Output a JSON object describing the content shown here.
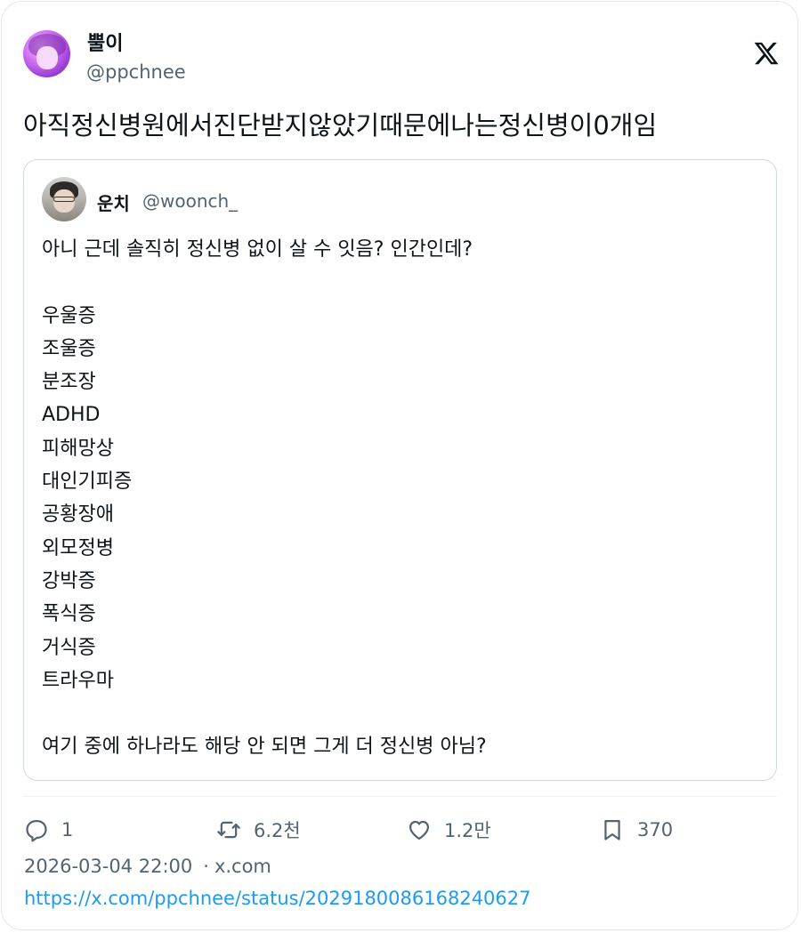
{
  "tweet": {
    "author": {
      "display_name": "뿔이",
      "handle": "@ppchnee"
    },
    "text": "아직정신병원에서진단받지않았기때문에나는정신병이0개임"
  },
  "quoted_tweet": {
    "author": {
      "display_name": "운치",
      "handle": "@woonch_"
    },
    "lines": [
      "아니 근데 솔직히 정신병 없이 살 수 잇음? 인간인데?",
      "",
      "우울증",
      "조울증",
      "분조장",
      "ADHD",
      "피해망상",
      "대인기피증",
      "공황장애",
      "외모정병",
      "강박증",
      "폭식증",
      "거식증",
      "트라우마",
      "",
      "여기 중에 하나라도 해당 안 되면 그게 더 정신병 아님?"
    ]
  },
  "actions": {
    "replies": "1",
    "retweets": "6.2천",
    "likes": "1.2만",
    "bookmarks": "370"
  },
  "meta": {
    "timestamp": "2026-03-04 22:00",
    "separator": "·",
    "source": "x.com",
    "url": "https://x.com/ppchnee/status/2029180086168240627"
  },
  "icons": {
    "brand": "x-logo-icon",
    "reply": "reply-bubble-icon",
    "retweet": "retweet-icon",
    "like": "heart-icon",
    "bookmark": "bookmark-icon"
  },
  "colors": {
    "text": "#0f1419",
    "secondary": "#536471",
    "link": "#1d9bf0",
    "border": "#cfd9de"
  }
}
